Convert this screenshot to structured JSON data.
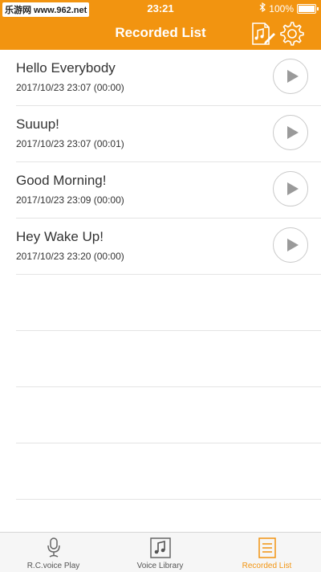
{
  "status_bar": {
    "watermark": "乐游网 www.962.net",
    "time": "23:21",
    "battery": "100%"
  },
  "header": {
    "title": "Recorded List",
    "icons": [
      "music-edit-icon",
      "gear-icon"
    ]
  },
  "recordings": [
    {
      "title": "Hello Everybody",
      "date": "2017/10/23 23:07 (00:00)"
    },
    {
      "title": "Suuup!",
      "date": "2017/10/23 23:07 (00:01)"
    },
    {
      "title": "Good Morning!",
      "date": "2017/10/23 23:09 (00:00)"
    },
    {
      "title": "Hey Wake Up!",
      "date": "2017/10/23 23:20 (00:00)"
    }
  ],
  "tabs": [
    {
      "label": "R.C.voice Play",
      "icon": "microphone-icon"
    },
    {
      "label": "Voice Library",
      "icon": "music-note-icon"
    },
    {
      "label": "Recorded List",
      "icon": "recorded-list-icon",
      "active": true
    }
  ],
  "colors": {
    "accent": "#f29410"
  }
}
